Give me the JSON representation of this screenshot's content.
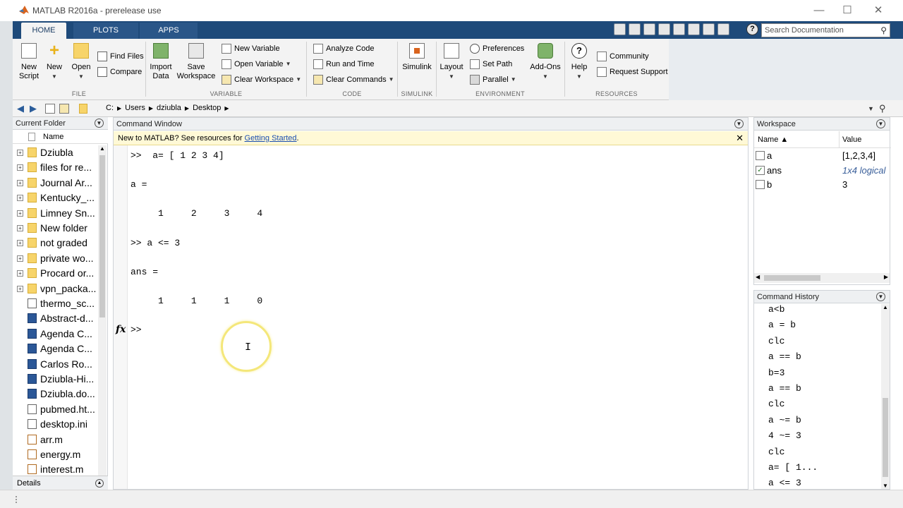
{
  "window": {
    "title": "MATLAB R2016a - prerelease use",
    "controls": [
      "—",
      "☐",
      "✕"
    ]
  },
  "tabs": [
    "HOME",
    "PLOTS",
    "APPS"
  ],
  "search_doc": {
    "placeholder": "Search Documentation"
  },
  "help_glyph": "?",
  "ribbon": {
    "file": {
      "label": "FILE",
      "new_script": "New\nScript",
      "new": "New",
      "open": "Open",
      "find_files": "Find Files",
      "compare": "Compare"
    },
    "variable": {
      "label": "VARIABLE",
      "import_data": "Import\nData",
      "save_workspace": "Save\nWorkspace",
      "new_variable": "New Variable",
      "open_variable": "Open Variable",
      "clear_workspace": "Clear Workspace"
    },
    "code": {
      "label": "CODE",
      "analyze_code": "Analyze Code",
      "run_and_time": "Run and Time",
      "clear_commands": "Clear Commands"
    },
    "simulink": {
      "label": "SIMULINK",
      "simulink": "Simulink"
    },
    "environment": {
      "label": "ENVIRONMENT",
      "layout": "Layout",
      "preferences": "Preferences",
      "set_path": "Set Path",
      "parallel": "Parallel",
      "add_ons": "Add-Ons"
    },
    "resources": {
      "label": "RESOURCES",
      "help": "Help",
      "community": "Community",
      "request_support": "Request Support"
    }
  },
  "address": {
    "crumbs": [
      "C:",
      "Users",
      "dziubla",
      "Desktop"
    ]
  },
  "current_folder": {
    "title": "Current Folder",
    "column": "Name",
    "items": [
      {
        "name": "Dziubla",
        "type": "folder"
      },
      {
        "name": "files for re...",
        "type": "folder"
      },
      {
        "name": "Journal Ar...",
        "type": "folder"
      },
      {
        "name": "Kentucky_...",
        "type": "folder"
      },
      {
        "name": "Limney Sn...",
        "type": "folder"
      },
      {
        "name": "New folder",
        "type": "folder"
      },
      {
        "name": "not graded",
        "type": "folder"
      },
      {
        "name": "private wo...",
        "type": "folder"
      },
      {
        "name": "Procard or...",
        "type": "folder"
      },
      {
        "name": "vpn_packa...",
        "type": "folder"
      },
      {
        "name": "thermo_sc...",
        "type": "file"
      },
      {
        "name": "Abstract-d...",
        "type": "word"
      },
      {
        "name": "Agenda C...",
        "type": "word"
      },
      {
        "name": "Agenda C...",
        "type": "word"
      },
      {
        "name": "Carlos Ro...",
        "type": "word"
      },
      {
        "name": "Dziubla-Hi...",
        "type": "word"
      },
      {
        "name": "Dziubla.do...",
        "type": "word"
      },
      {
        "name": "pubmed.ht...",
        "type": "file"
      },
      {
        "name": "desktop.ini",
        "type": "file"
      },
      {
        "name": "arr.m",
        "type": "m"
      },
      {
        "name": "energy.m",
        "type": "m"
      },
      {
        "name": "interest.m",
        "type": "m"
      }
    ],
    "details": "Details"
  },
  "command_window": {
    "title": "Command Window",
    "banner_text": "New to MATLAB? See resources for ",
    "banner_link": "Getting Started",
    "banner_end": ".",
    "lines": [
      ">>  a= [ 1 2 3 4]",
      "",
      "a =",
      "",
      "     1     2     3     4",
      "",
      ">> a <= 3",
      "",
      "ans =",
      "",
      "     1     1     1     0",
      "",
      ">> "
    ],
    "fx": "fx",
    "ibeam": "I"
  },
  "workspace": {
    "title": "Workspace",
    "col_name": "Name ▲",
    "col_value": "Value",
    "rows": [
      {
        "name": "a",
        "value": "[1,2,3,4]",
        "italic": false
      },
      {
        "name": "ans",
        "value": "1x4 logical",
        "italic": true
      },
      {
        "name": "b",
        "value": "3",
        "italic": false
      }
    ]
  },
  "command_history": {
    "title": "Command History",
    "lines": [
      "a<b",
      "a = b",
      "clc",
      "a == b",
      "b=3",
      "a == b",
      "clc",
      "a ~= b",
      "4 ~= 3",
      "clc",
      "a= [ 1...",
      "a <= 3"
    ]
  }
}
